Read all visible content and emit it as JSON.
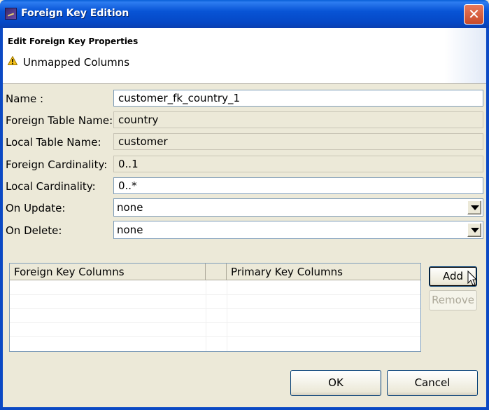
{
  "window": {
    "title": "Foreign Key Edition",
    "close_label": "✕"
  },
  "header": {
    "title": "Edit Foreign Key Properties",
    "message": "Unmapped Columns"
  },
  "form": {
    "name_label": "Name :",
    "name_value": "customer_fk_country_1",
    "foreign_table_label": "Foreign Table Name:",
    "foreign_table_value": "country",
    "local_table_label": "Local Table Name:",
    "local_table_value": "customer",
    "foreign_cardinality_label": "Foreign Cardinality:",
    "foreign_cardinality_value": "0..1",
    "local_cardinality_label": "Local Cardinality:",
    "local_cardinality_value": "0..*",
    "on_update_label": "On Update:",
    "on_update_value": "none",
    "on_delete_label": "On Delete:",
    "on_delete_value": "none"
  },
  "table": {
    "columns": [
      "Foreign Key Columns",
      "",
      "Primary Key Columns"
    ]
  },
  "buttons": {
    "add": "Add",
    "remove": "Remove",
    "ok": "OK",
    "cancel": "Cancel"
  },
  "icons": {
    "warning": "warning-icon",
    "app": "app-icon",
    "dropdown": "chevron-down-icon"
  }
}
